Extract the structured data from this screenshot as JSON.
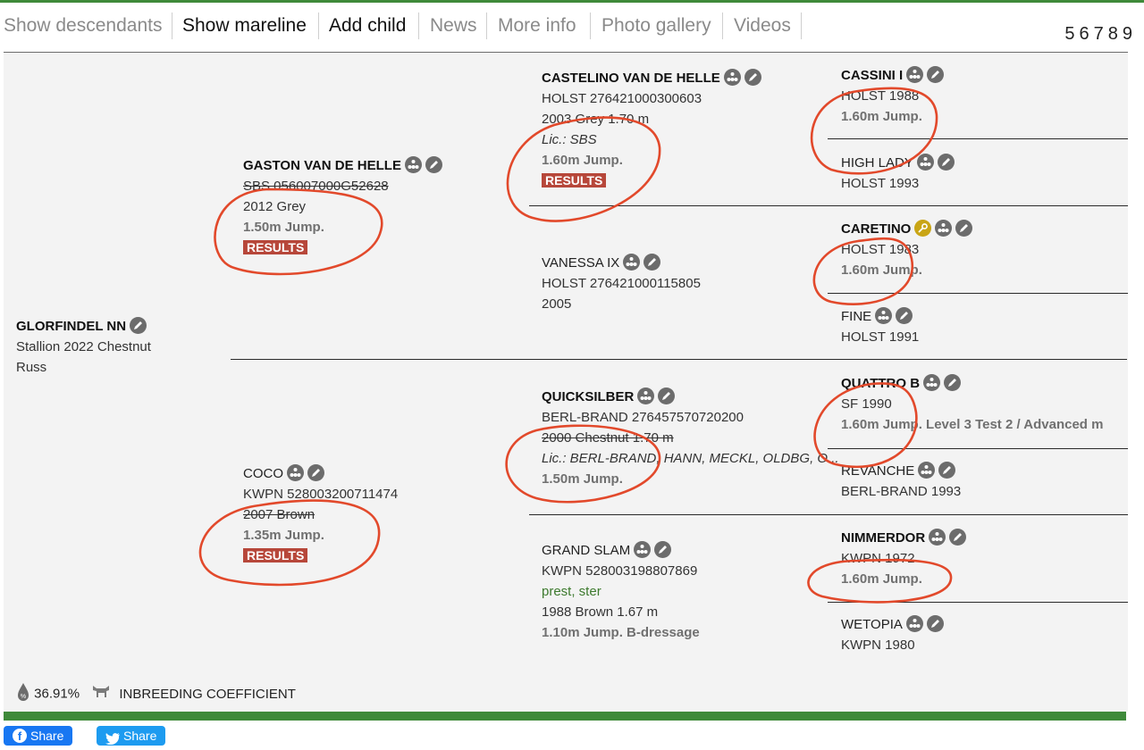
{
  "nav": {
    "items": [
      "Show descendants",
      "Show mareline",
      "Add child",
      "News",
      "More info",
      "Photo gallery",
      "Videos"
    ],
    "generations": [
      "5",
      "6",
      "7",
      "8",
      "9"
    ]
  },
  "subject": {
    "name": "GLORFINDEL NN",
    "line1": "Stallion 2022 Chestnut",
    "line2": "Russ"
  },
  "sire": {
    "name": "GASTON VAN DE HELLE",
    "reg": "SBS 056007000G52628",
    "year": "2012 Grey",
    "jump": "1.50m Jump.",
    "results": "RESULTS"
  },
  "dam": {
    "name": "COCO",
    "reg": "KWPN 528003200711474",
    "year": "2007 Brown",
    "jump": "1.35m Jump.",
    "results": "RESULTS"
  },
  "ss": {
    "name": "CASTELINO VAN DE HELLE",
    "reg": "HOLST 276421000300603",
    "year": "2003 Grey 1.70 m",
    "lic": "Lic.: SBS",
    "jump": "1.60m Jump.",
    "results": "RESULTS"
  },
  "sd": {
    "name": "VANESSA IX",
    "reg": "HOLST 276421000115805",
    "year": "2005"
  },
  "ds": {
    "name": "QUICKSILBER",
    "reg": "BERL-BRAND 276457570720200",
    "year": "2000 Chestnut 1.70 m",
    "lic": "Lic.: BERL-BRAND, HANN, MECKL, OLDBG, O...",
    "jump": "1.50m Jump."
  },
  "dd": {
    "name": "GRAND SLAM",
    "reg": "KWPN 528003198807869",
    "pred": "prest, ster",
    "year": "1988 Brown 1.67 m",
    "jump": "1.10m Jump. B-dressage"
  },
  "g3": [
    {
      "name": "CASSINI I",
      "reg": "HOLST 1988",
      "jump": "1.60m Jump."
    },
    {
      "name": "HIGH LADY",
      "reg": "HOLST 1993"
    },
    {
      "name": "CARETINO",
      "reg": "HOLST 1983",
      "jump": "1.60m Jump."
    },
    {
      "name": "FINE",
      "reg": "HOLST 1991"
    },
    {
      "name": "QUATTRO B",
      "reg": "SF 1990",
      "jump": "1.60m Jump. Level 3 Test 2 / Advanced m"
    },
    {
      "name": "REVANCHE",
      "reg": "BERL-BRAND 1993"
    },
    {
      "name": "NIMMERDOR",
      "reg": "KWPN 1972",
      "jump": "1.60m Jump."
    },
    {
      "name": "WETOPIA",
      "reg": "KWPN 1980"
    }
  ],
  "inbreeding": {
    "value": "36.91%",
    "label": "INBREEDING COEFFICIENT"
  },
  "share": {
    "facebook": "Share",
    "twitter": "Share"
  },
  "colors": {
    "accent_green": "#3f8a3a",
    "results_red": "#b7473a",
    "annotation_red": "#e2492b",
    "facebook": "#1877f2",
    "twitter": "#1d9bf0"
  },
  "icons": [
    "pedigree-icon",
    "edit-icon",
    "key-icon",
    "dna-icon",
    "horse-icon",
    "facebook-icon",
    "twitter-icon"
  ]
}
